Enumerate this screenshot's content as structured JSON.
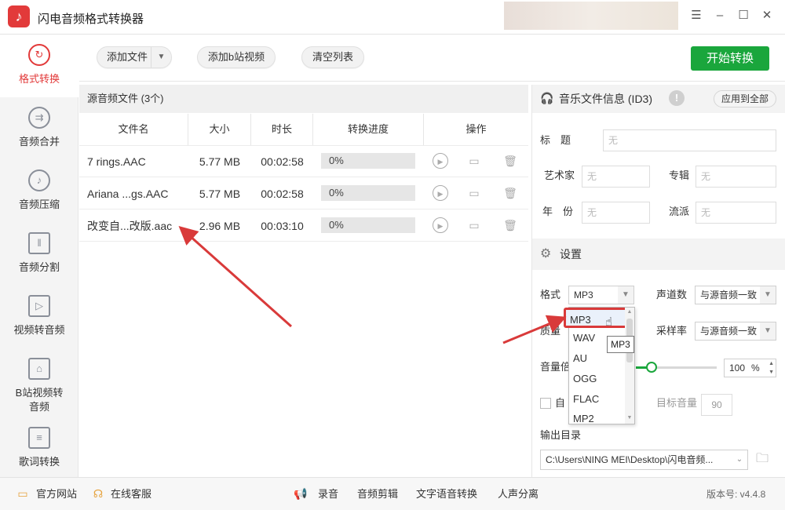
{
  "app": {
    "title": "闪电音频格式转换器",
    "logo_icon": "music-note-icon",
    "accent": "#e23a3a",
    "green": "#1aa63c"
  },
  "window_controls": {
    "menu": "☰",
    "minimize": "–",
    "maximize": "☐",
    "close": "✕"
  },
  "sidebar": {
    "items": [
      {
        "label": "格式转换",
        "icon": "refresh-icon",
        "glyph": "↻",
        "active": true
      },
      {
        "label": "音频合并",
        "icon": "merge-icon",
        "glyph": "⇉"
      },
      {
        "label": "音频压缩",
        "icon": "music-note-icon",
        "glyph": "♪"
      },
      {
        "label": "音频分割",
        "icon": "split-icon",
        "glyph": "‖"
      },
      {
        "label": "视频转音频",
        "icon": "video-icon",
        "glyph": "▷"
      },
      {
        "label": "B站视频转\n音频",
        "icon": "bilibili-icon",
        "glyph": "⌂"
      },
      {
        "label": "歌词转换",
        "icon": "lyrics-icon",
        "glyph": "≡"
      }
    ]
  },
  "toolbar": {
    "add_file": "添加文件",
    "add_bilibili": "添加b站视频",
    "clear_list": "清空列表",
    "start": "开始转换"
  },
  "files": {
    "header": "源音频文件 (3个)",
    "columns": [
      "文件名",
      "大小",
      "时长",
      "转换进度",
      "操作"
    ],
    "rows": [
      {
        "name": "7 rings.AAC",
        "size": "5.77 MB",
        "duration": "00:02:58",
        "progress": "0%"
      },
      {
        "name": "Ariana ...gs.AAC",
        "size": "5.77 MB",
        "duration": "00:02:58",
        "progress": "0%"
      },
      {
        "name": "改变自...改版.aac",
        "size": "2.96 MB",
        "duration": "00:03:10",
        "progress": "0%"
      }
    ]
  },
  "id3": {
    "title": "音乐文件信息 (ID3)",
    "apply_all": "应用到全部",
    "labels": {
      "title": "标　题",
      "artist": "艺术家",
      "album": "专辑",
      "year": "年　份",
      "genre": "流派"
    },
    "placeholder": "无"
  },
  "settings": {
    "title": "设置",
    "format_label": "格式",
    "format_value": "MP3",
    "channels_label": "声道数",
    "channels_value": "与源音频一致",
    "quality_label": "质量",
    "samplerate_label": "采样率",
    "samplerate_value": "与源音频一致",
    "volume_label": "音量倍",
    "volume_value": "100",
    "volume_unit": "%",
    "auto_label": "自",
    "target_volume_label": "目标音量",
    "target_volume_value": "90",
    "output_label": "输出目录",
    "output_path": "C:\\Users\\NING MEI\\Desktop\\闪电音频...",
    "dropdown_options": [
      "MP3",
      "WAV",
      "AU",
      "OGG",
      "FLAC",
      "MP2"
    ],
    "tooltip": "MP3"
  },
  "footer": {
    "website": "官方网站",
    "support": "在线客服",
    "record": "录音",
    "edit": "音频剪辑",
    "tts": "文字语音转换",
    "vocal": "人声分离",
    "version": "版本号: v4.4.8"
  }
}
